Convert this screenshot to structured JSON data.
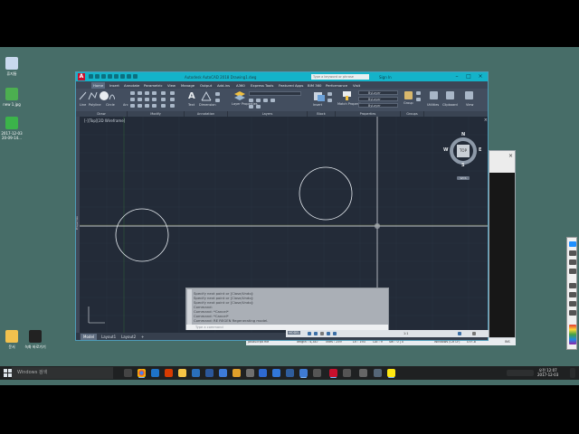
{
  "desktop": {
    "icons": [
      {
        "label": "휴지통",
        "glyph": "recycle-bin",
        "color": "#c9d9ee"
      },
      {
        "label": "new 1.jpg",
        "glyph": "image-file",
        "color": "#4caf50"
      },
      {
        "label": "2017-12-03 20-09-14...",
        "glyph": "spreadsheet-file",
        "color": "#3bb44a"
      },
      {
        "label": "문서",
        "glyph": "document-file",
        "color": "#f2c14e"
      },
      {
        "label": "녹화 바로가기",
        "glyph": "shortcut",
        "color": "#222222"
      }
    ]
  },
  "acad": {
    "logo": "A",
    "title": "Autodesk AutoCAD 2018   Drawing1.dwg",
    "search_placeholder": "Type a keyword or phrase",
    "sign_in": "Sign In",
    "menu": [
      "Home",
      "Insert",
      "Annotate",
      "Parametric",
      "View",
      "Manage",
      "Output",
      "Add-ins",
      "A360",
      "Express Tools",
      "Featured Apps",
      "BIM 360",
      "Performance",
      "Visit"
    ],
    "ribbon": {
      "draw_tools": [
        "Line",
        "Polyline",
        "Circle",
        "Arc"
      ],
      "annotation_tools": [
        "Text",
        "Dimension"
      ],
      "layer_tool": "Layer Properties",
      "block_tool": "Insert",
      "match_tool": "Match Properties",
      "props": [
        "ByLayer",
        "ByLayer",
        "ByLayer"
      ],
      "group_tool": "Group",
      "utilities": "Utilities",
      "clipboard": "Clipboard",
      "view": "View",
      "panels": [
        "Draw",
        "Modify",
        "Annotation",
        "Layers",
        "Block",
        "Properties",
        "Groups"
      ]
    },
    "viewport_label": "[-][Top][2D Wireframe]",
    "viewcube": {
      "top": "TOP",
      "n": "N",
      "s": "S",
      "e": "E",
      "w": "W",
      "wcs": "WCS"
    },
    "command": {
      "lines": [
        "Specify next point or [Close/Undo]:",
        "Specify next point or [Close/Undo]:",
        "Specify next point or [Close/Undo]:",
        "Command:",
        "Command: *Cancel*",
        "Command: *Cancel*",
        "Command: RE REGEN Regenerating model."
      ],
      "placeholder": "Type a command"
    },
    "tabs": [
      "Model",
      "Layout1",
      "Layout2",
      "+"
    ],
    "status": {
      "mode": "MODEL",
      "scale": "1:1"
    }
  },
  "side_window": {
    "close": "×"
  },
  "statusbar": {
    "left": "JavaScript file",
    "length": "length : 4,347",
    "lines": "lines : 259",
    "ln": "Ln : 193",
    "col": "Col : 9",
    "sel": "Sel : 0 | 0",
    "eol": "Windows (CR LF)",
    "enc": "UTF-8",
    "ins": "INS"
  },
  "taskbar": {
    "search_placeholder": "Windows 검색",
    "apps": [
      "task-view",
      "chrome",
      "mail",
      "folder",
      "store",
      "word",
      "powerpoint",
      "edge",
      "explorer",
      "settings",
      "media",
      "chrome-2",
      "firefox",
      "autocad",
      "maps",
      "gimp",
      "unknown",
      "video",
      "kakaotalk"
    ],
    "time": "오전 12:07",
    "date": "2017-12-03"
  }
}
